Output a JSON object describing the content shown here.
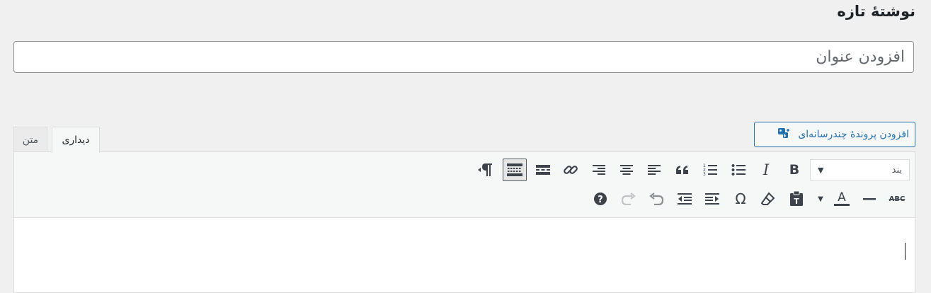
{
  "page": {
    "title": "نوشتهٔ تازه"
  },
  "title_field": {
    "placeholder": "افزودن عنوان"
  },
  "media_button": {
    "label": "افزودن پروندهٔ چندرسانه‌ای",
    "icon": "media-add-icon"
  },
  "editor_tabs": [
    {
      "label": "دیداری",
      "active": true
    },
    {
      "label": "متن",
      "active": false
    }
  ],
  "toolbar": {
    "format_select": {
      "selected": "بند"
    },
    "row1": [
      "bold",
      "italic",
      "bullet-list",
      "numbered-list",
      "blockquote",
      "align-left",
      "align-center",
      "align-right",
      "link",
      "read-more",
      "toolbar-toggle",
      "rtl-direction"
    ],
    "row2": [
      "strikethrough",
      "horizontal-line",
      "text-color",
      "paste-as-text",
      "clear-formatting",
      "special-character",
      "indent",
      "outdent",
      "undo",
      "redo",
      "help"
    ]
  },
  "colors": {
    "accent": "#2271b1",
    "text": "#1d2327",
    "background": "#f0f0f1",
    "border": "#dcdcde"
  }
}
